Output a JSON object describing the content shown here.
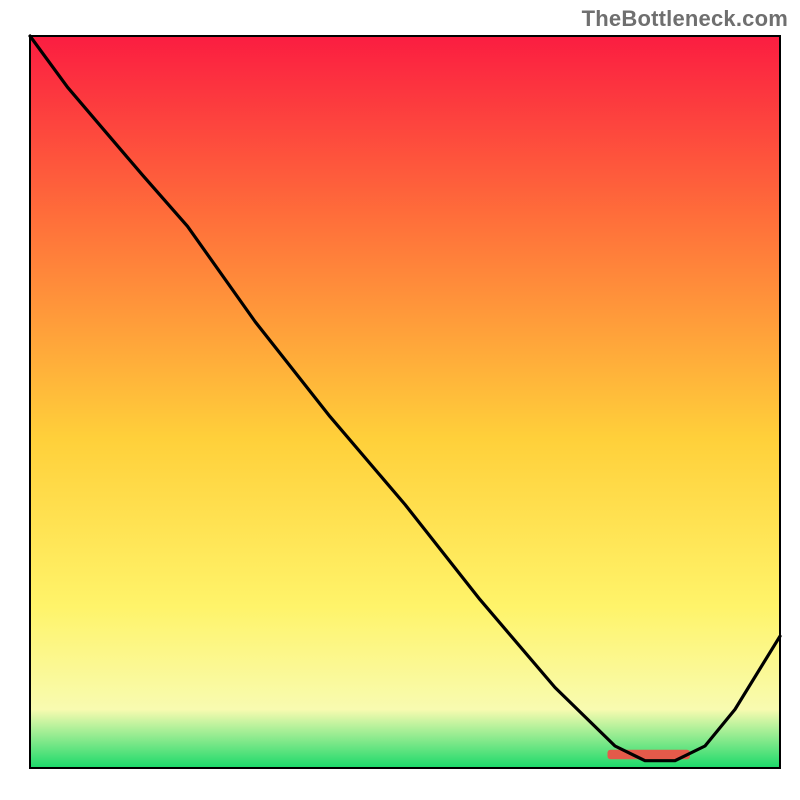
{
  "watermark": "TheBottleneck.com",
  "chart_data": {
    "type": "line",
    "title": "",
    "xlabel": "",
    "ylabel": "",
    "xlim": [
      0,
      100
    ],
    "ylim": [
      0,
      100
    ],
    "grid": false,
    "legend": false,
    "background_gradient": {
      "top": "#fb1d41",
      "upper_mid": "#ff6f3a",
      "mid": "#ffd03a",
      "lower_mid": "#fff46a",
      "lower": "#f8fbb0",
      "base": "#1bd96a"
    },
    "series": [
      {
        "name": "curve",
        "color": "#000000",
        "x": [
          0,
          5,
          10,
          15,
          21,
          30,
          40,
          50,
          60,
          70,
          78,
          82,
          86,
          90,
          94,
          100
        ],
        "y": [
          100,
          93,
          87,
          81,
          74,
          61,
          48,
          36,
          23,
          11,
          3,
          1,
          1,
          3,
          8,
          18
        ]
      }
    ],
    "annotations": [
      {
        "name": "trough-marker",
        "color": "#e45a4a",
        "x0": 77,
        "x1": 88,
        "y": 1.2,
        "height": 1.3
      }
    ]
  }
}
